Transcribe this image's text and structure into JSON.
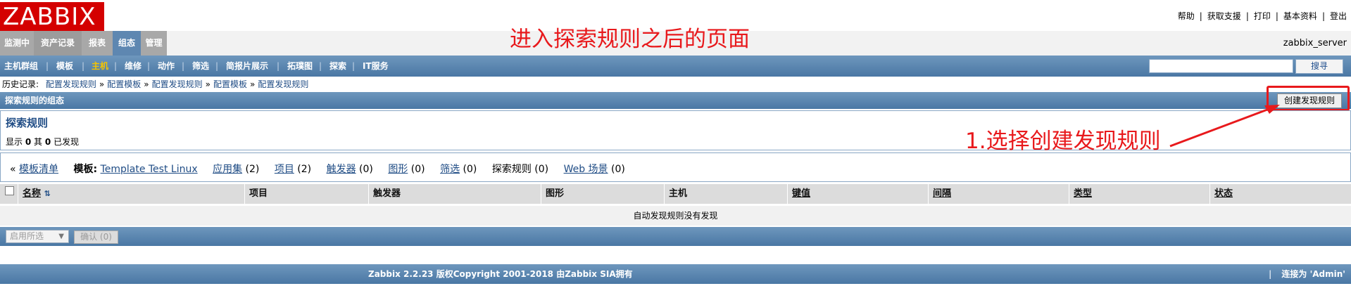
{
  "header": {
    "logo": "ZABBIX",
    "links": [
      "帮助",
      "获取支援",
      "打印",
      "基本资料",
      "登出"
    ],
    "server": "zabbix_server"
  },
  "annotations": {
    "page_note": "进入探索规则之后的页面",
    "step_note": "1.选择创建发现规则"
  },
  "main_tabs": [
    "监测中",
    "资产记录",
    "报表",
    "组态",
    "管理"
  ],
  "subnav": {
    "items": [
      "主机群组",
      "模板",
      "主机",
      "维修",
      "动作",
      "筛选",
      "简报片展示",
      "拓璞图",
      "探索",
      "IT服务"
    ],
    "active": "主机",
    "search_button": "搜寻"
  },
  "history": {
    "label": "历史记录:",
    "items": [
      "配置发现规则",
      "配置模板",
      "配置发现规则",
      "配置模板",
      "配置发现规则"
    ]
  },
  "section": {
    "title": "探索规则的组态",
    "create_button": "创建发现规则"
  },
  "page": {
    "heading": "探索规则",
    "summary_prefix": "显示",
    "shown": "0",
    "summary_mid": "其",
    "found": "0",
    "summary_suffix": "已发现"
  },
  "template_bar": {
    "back_prefix": "«",
    "back_link": "模板清单",
    "template_label": "模板:",
    "template_name": "Template Test Linux",
    "applications": "应用集",
    "applications_count": "(2)",
    "items": "项目",
    "items_count": "(2)",
    "triggers": "触发器",
    "triggers_count": "(0)",
    "graphs": "图形",
    "graphs_count": "(0)",
    "filters": "筛选",
    "filters_count": "(0)",
    "discovery": "探索规则",
    "discovery_count": "(0)",
    "web": "Web 场景",
    "web_count": "(0)"
  },
  "table": {
    "columns": [
      "名称",
      "项目",
      "触发器",
      "图形",
      "主机",
      "键值",
      "间隔",
      "类型",
      "状态"
    ],
    "empty_text": "自动发现规则没有发现"
  },
  "actions": {
    "select_value": "启用所选",
    "confirm_button": "确认 (0)"
  },
  "footer": {
    "copyright": "Zabbix 2.2.23 版权Copyright 2001-2018 由Zabbix SIA拥有",
    "connected": "连接为 'Admin'"
  },
  "colors": {
    "logo_red": "#d40000",
    "nav_blue": "#4a77a4",
    "annotation_red": "#e8191c",
    "active_gold": "#f5c500"
  }
}
